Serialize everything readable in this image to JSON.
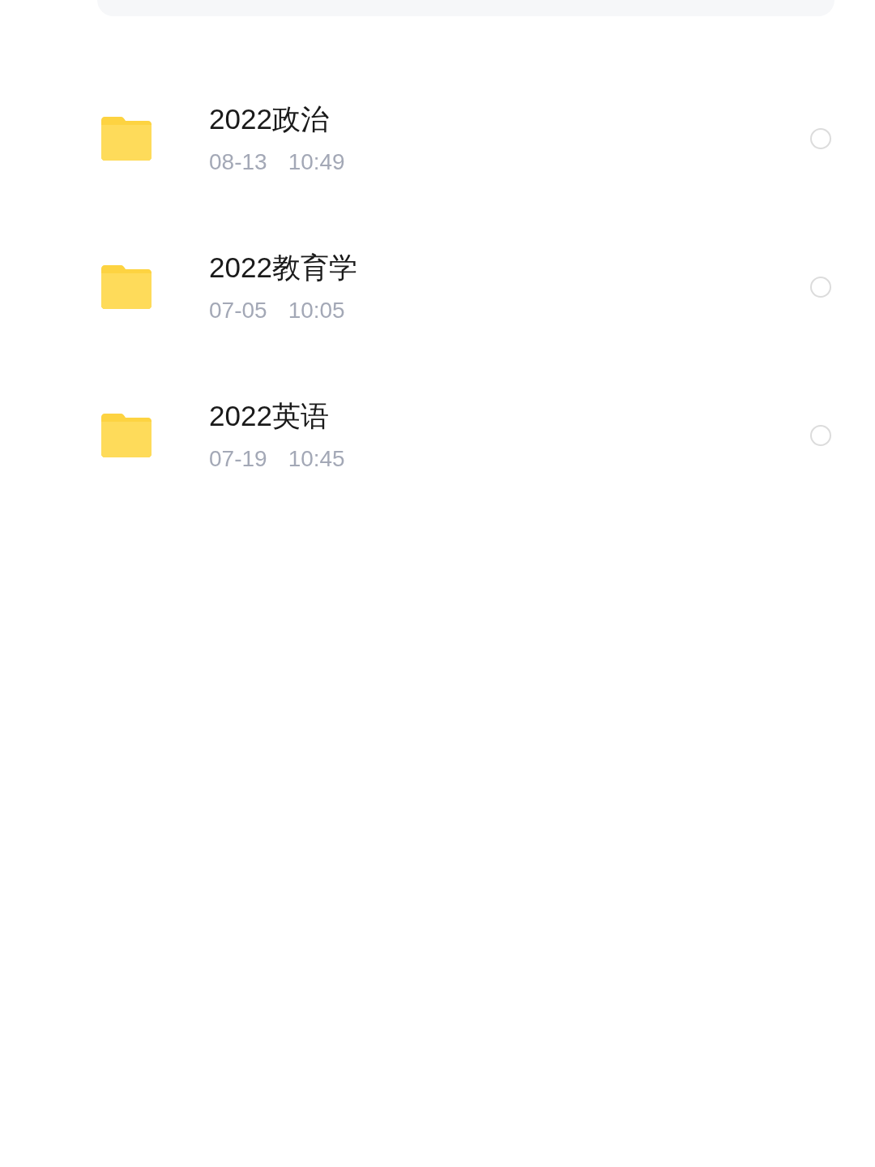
{
  "folders": [
    {
      "name": "2022政治",
      "date": "08-13",
      "time": "10:49",
      "selected": false
    },
    {
      "name": "2022教育学",
      "date": "07-05",
      "time": "10:05",
      "selected": false
    },
    {
      "name": "2022英语",
      "date": "07-19",
      "time": "10:45",
      "selected": false
    }
  ]
}
